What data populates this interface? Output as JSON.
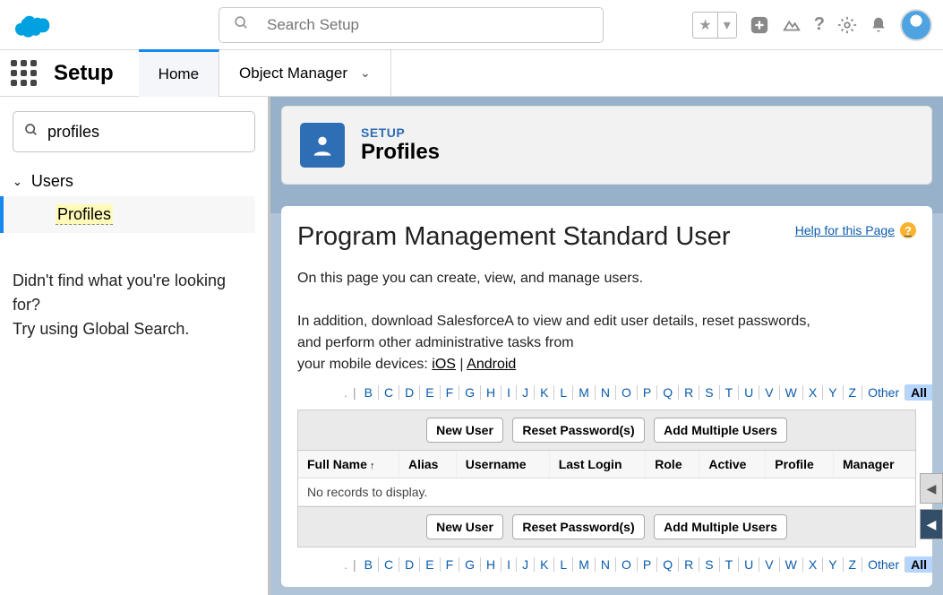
{
  "header": {
    "search_placeholder": "Search Setup"
  },
  "nav": {
    "brand": "Setup",
    "tabs": [
      "Home",
      "Object Manager"
    ]
  },
  "sidebar": {
    "quick_find_value": "profiles",
    "group_label": "Users",
    "item_label": "Profiles",
    "help_line1": "Didn't find what you're looking for?",
    "help_line2": "Try using Global Search."
  },
  "page_header": {
    "eyebrow": "SETUP",
    "title": "Profiles"
  },
  "content": {
    "record_title": "Program Management Standard User",
    "help_link": "Help for this Page",
    "desc_line1": "On this page you can create, view, and manage users.",
    "desc_line2a": "In addition, download SalesforceA to view and edit user details, reset passwords,",
    "desc_line2b": "and perform other administrative tasks from",
    "desc_line2c": "your mobile devices: ",
    "ios": "iOS",
    "android": "Android",
    "letters": [
      "B",
      "C",
      "D",
      "E",
      "F",
      "G",
      "H",
      "I",
      "J",
      "K",
      "L",
      "M",
      "N",
      "O",
      "P",
      "Q",
      "R",
      "S",
      "T",
      "U",
      "V",
      "W",
      "X",
      "Y",
      "Z"
    ],
    "other": "Other",
    "all": "All",
    "buttons": {
      "new_user": "New User",
      "reset_pw": "Reset Password(s)",
      "add_multi": "Add Multiple Users"
    },
    "columns": [
      "Full Name",
      "Alias",
      "Username",
      "Last Login",
      "Role",
      "Active",
      "Profile",
      "Manager"
    ],
    "empty": "No records to display."
  }
}
